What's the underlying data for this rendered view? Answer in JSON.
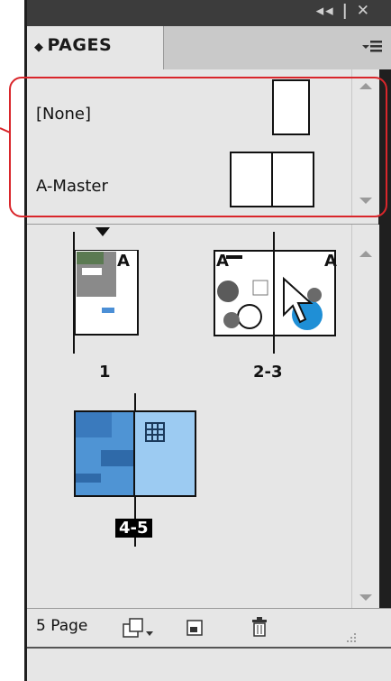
{
  "panel": {
    "window_controls": "◂◂ | ✕",
    "tab_label": "PAGES",
    "menu_icon": "panel-menu-icon"
  },
  "masters": [
    {
      "label": "[None]",
      "thumbnail": "single"
    },
    {
      "label": "A-Master",
      "thumbnail": "spread"
    }
  ],
  "pages": [
    {
      "label": "1",
      "prefix": "A"
    },
    {
      "label": "2-3",
      "prefix": "A"
    },
    {
      "label": "4-5",
      "prefix": "",
      "selected": true
    }
  ],
  "footer": {
    "page_count": "5 Page"
  },
  "colors": {
    "callout": "#d9262b",
    "selected_label_bg": "#000000",
    "page_blue": "#9ccbf2"
  }
}
